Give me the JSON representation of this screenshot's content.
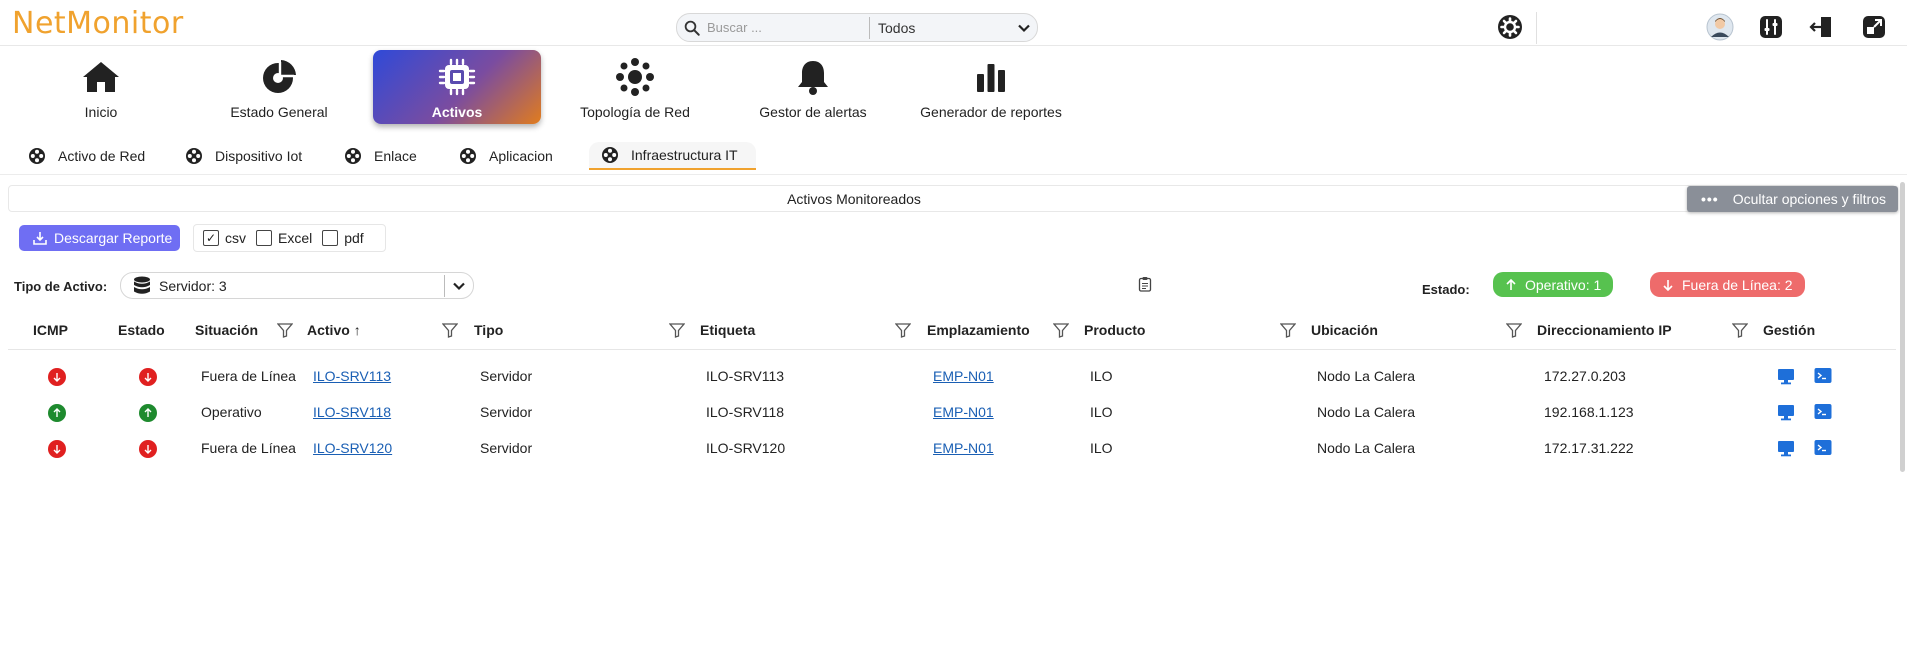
{
  "app": {
    "title": "NetMonitor"
  },
  "search": {
    "placeholder": "Buscar ...",
    "value": "",
    "scope": "Todos"
  },
  "nav": {
    "items": [
      {
        "label": "Inicio",
        "icon": "home-icon"
      },
      {
        "label": "Estado General",
        "icon": "pie-chart-icon"
      },
      {
        "label": "Activos",
        "icon": "chip-icon",
        "active": true
      },
      {
        "label": "Topología de Red",
        "icon": "network-icon"
      },
      {
        "label": "Gestor de alertas",
        "icon": "bell-icon"
      },
      {
        "label": "Generador de reportes",
        "icon": "bar-chart-icon"
      }
    ]
  },
  "subtabs": [
    {
      "label": "Activo de Red"
    },
    {
      "label": "Dispositivo Iot"
    },
    {
      "label": "Enlace"
    },
    {
      "label": "Aplicacion"
    },
    {
      "label": "Infraestructura IT",
      "active": true
    }
  ],
  "section": {
    "title": "Activos Monitoreados",
    "hide_options_label": "Ocultar opciones y filtros"
  },
  "report": {
    "download_label": "Descargar Reporte",
    "formats": [
      {
        "label": "csv",
        "checked": true
      },
      {
        "label": "Excel",
        "checked": false
      },
      {
        "label": "pdf",
        "checked": false
      }
    ]
  },
  "filters": {
    "type_label": "Tipo de Activo:",
    "type_value": "Servidor: 3",
    "estado_label": "Estado:",
    "operativo_badge": "Operativo: 1",
    "fuera_badge": "Fuera de Línea: 2"
  },
  "table": {
    "columns": [
      "ICMP",
      "Estado",
      "Situación",
      "Activo",
      "Tipo",
      "Etiqueta",
      "Emplazamiento",
      "Producto",
      "Ubicación",
      "Direccionamiento IP",
      "Gestión"
    ],
    "sort_indicator": "↑",
    "rows": [
      {
        "icmp": "down",
        "estado": "down",
        "situacion": "Fuera de Línea",
        "activo": "ILO-SRV113",
        "tipo": "Servidor",
        "etiqueta": "ILO-SRV113",
        "emplazamiento": "EMP-N01",
        "producto": "ILO",
        "ubicacion": "Nodo La Calera",
        "ip": "172.27.0.203"
      },
      {
        "icmp": "up",
        "estado": "up",
        "situacion": "Operativo",
        "activo": "ILO-SRV118",
        "tipo": "Servidor",
        "etiqueta": "ILO-SRV118",
        "emplazamiento": "EMP-N01",
        "producto": "ILO",
        "ubicacion": "Nodo La Calera",
        "ip": "192.168.1.123"
      },
      {
        "icmp": "down",
        "estado": "down",
        "situacion": "Fuera de Línea",
        "activo": "ILO-SRV120",
        "tipo": "Servidor",
        "etiqueta": "ILO-SRV120",
        "emplazamiento": "EMP-N01",
        "producto": "ILO",
        "ubicacion": "Nodo La Calera",
        "ip": "172.17.31.222"
      }
    ]
  },
  "colors": {
    "brand": "#f0a22e",
    "up": "#1e8a2e",
    "down": "#e02020",
    "link": "#1a5fb4",
    "download": "#6f6ef3"
  }
}
